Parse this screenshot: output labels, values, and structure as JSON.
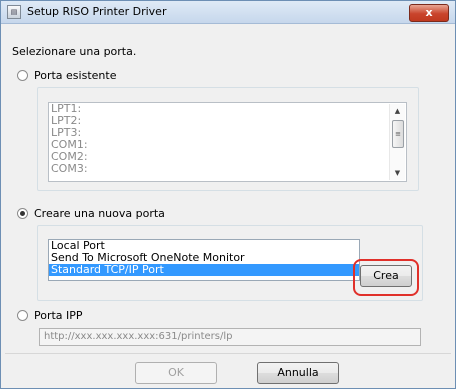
{
  "window": {
    "title": "Setup RISO Printer Driver",
    "close_label": "x"
  },
  "prompt": "Selezionare una porta.",
  "existing_port": {
    "label": "Porta esistente",
    "selected": false,
    "items": [
      "LPT1:",
      "LPT2:",
      "LPT3:",
      "COM1:",
      "COM2:",
      "COM3:"
    ]
  },
  "new_port": {
    "label": "Creare una nuova porta",
    "selected": true,
    "items": [
      "Local Port",
      "Send To Microsoft OneNote Monitor",
      "Standard TCP/IP Port"
    ],
    "selected_item": "Standard TCP/IP Port",
    "create_button": "Crea"
  },
  "ipp_port": {
    "label": "Porta IPP",
    "selected": false,
    "url": "http://xxx.xxx.xxx.xxx:631/printers/lp"
  },
  "footer": {
    "ok_label": "OK",
    "cancel_label": "Annulla"
  },
  "colors": {
    "selection": "#3399ff",
    "highlight": "#e0302a",
    "close": "#c0391f"
  }
}
